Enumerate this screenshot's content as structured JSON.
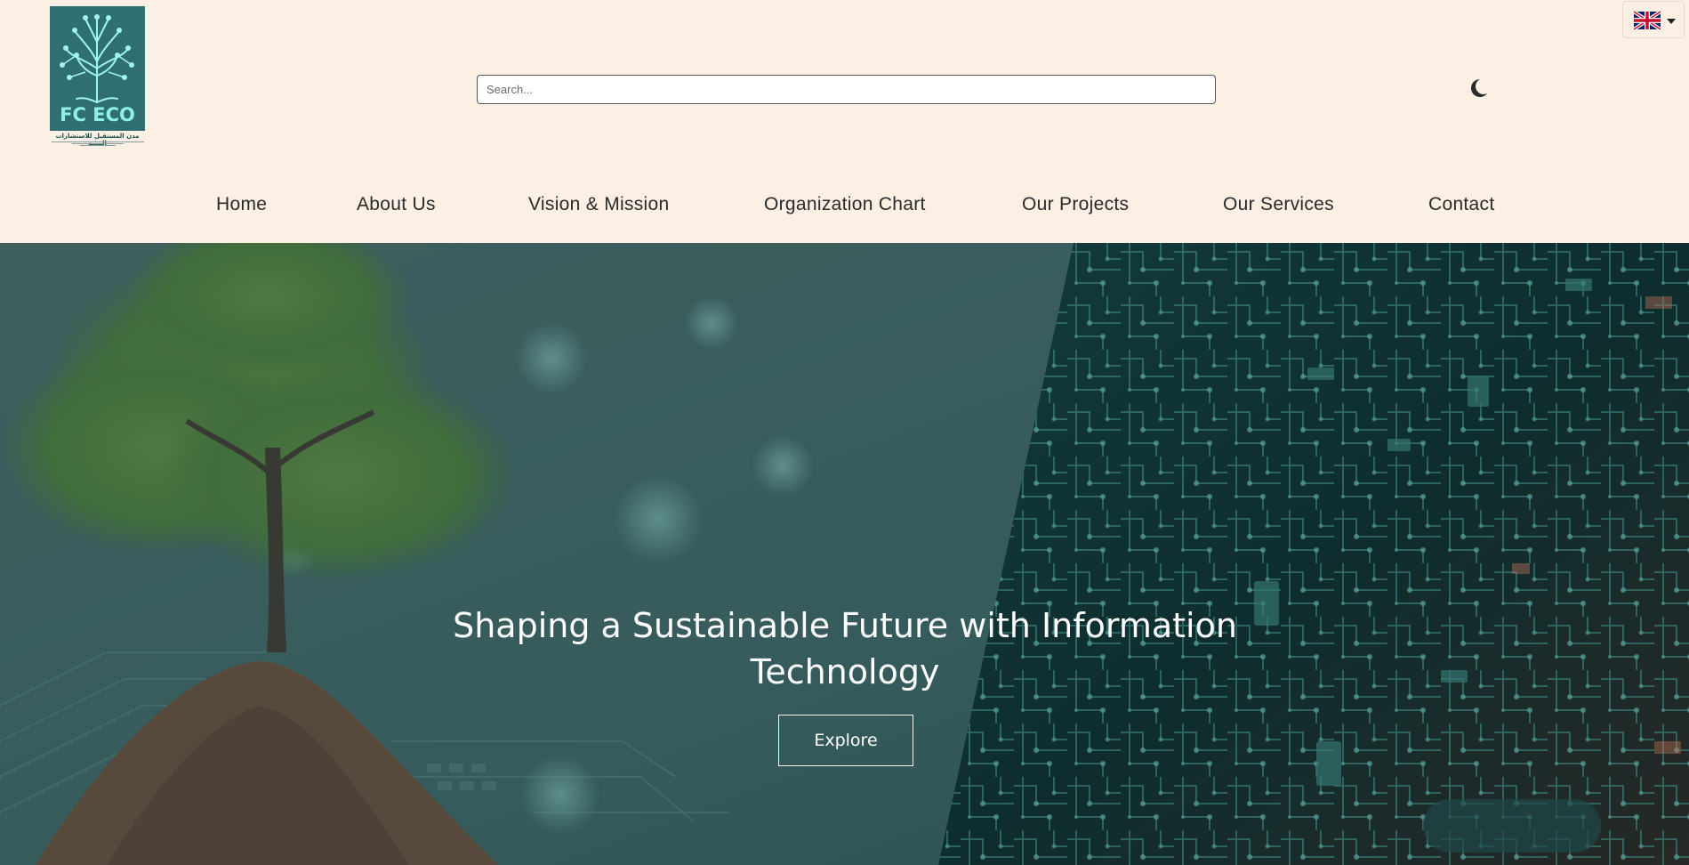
{
  "logo": {
    "text": "FC ECO",
    "arabic": "مدن المستقبل للاستشارات البيئية",
    "icon": "tree-circuit-logo"
  },
  "search": {
    "placeholder": "Search..."
  },
  "theme_toggle": {
    "icon": "moon-icon"
  },
  "language": {
    "icon": "uk-flag-icon"
  },
  "nav": {
    "items": [
      {
        "label": "Home"
      },
      {
        "label": "About Us"
      },
      {
        "label": "Vision & Mission"
      },
      {
        "label": "Organization Chart"
      },
      {
        "label": "Our Projects"
      },
      {
        "label": "Our Services"
      },
      {
        "label": "Contact"
      }
    ]
  },
  "hero": {
    "title": "Shaping a Sustainable Future with Information Technology",
    "button_label": "Explore"
  },
  "colors": {
    "header_bg": "#fbf0e3",
    "logo_bg": "#2f6e72",
    "hero_overlay": "#3d6466",
    "text": "#2a2a2a"
  }
}
